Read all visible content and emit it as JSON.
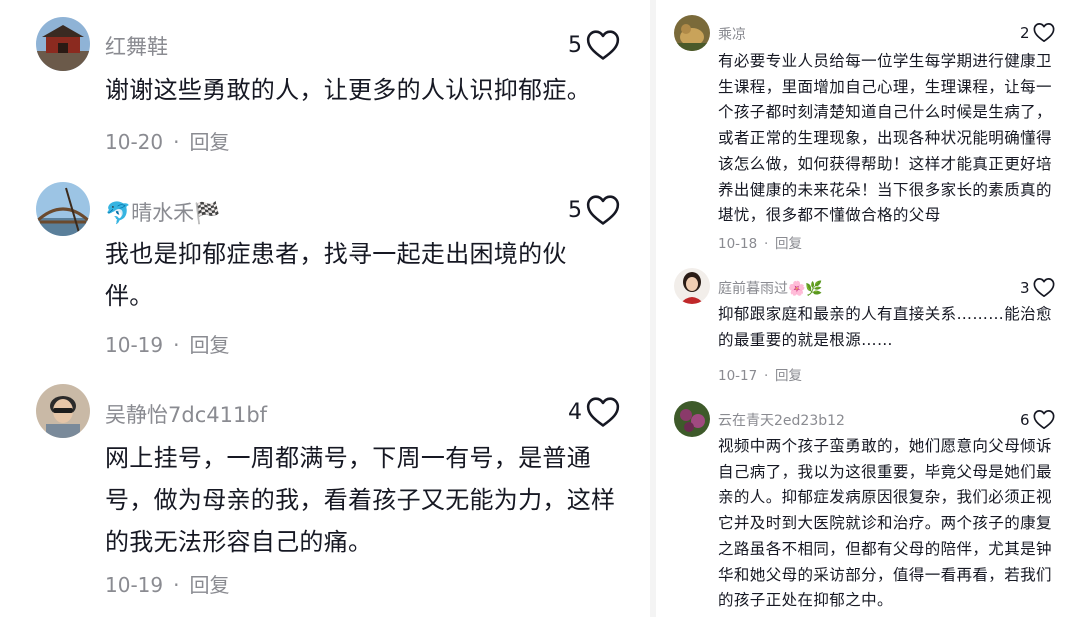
{
  "left_comments": [
    {
      "username": "红舞鞋",
      "text": "谢谢这些勇敢的人，让更多的人认识抑郁症。",
      "date": "10-20",
      "reply_label": "回复",
      "likes": "5",
      "avatar_icon": "building-photo-avatar"
    },
    {
      "username": "🐬晴水禾🏁",
      "text": "我也是抑郁症患者，找寻一起走出困境的伙伴。",
      "date": "10-19",
      "reply_label": "回复",
      "likes": "5",
      "avatar_icon": "bridge-photo-avatar"
    },
    {
      "username": "吴静怡7dc411bf",
      "text": "网上挂号，一周都满号，下周一有号，是普通号，做为母亲的我，看着孩子又无能为力，这样的我无法形容自己的痛。",
      "date": "10-19",
      "reply_label": "回复",
      "likes": "4",
      "avatar_icon": "person-photo-avatar"
    }
  ],
  "right_comments": [
    {
      "username": "乘凉",
      "text": "有必要专业人员给每一位学生每学期进行健康卫生课程，里面增加自己心理，生理课程，让每一个孩子都时刻清楚知道自己什么时候是生病了，或者正常的生理现象，出现各种状况能明确懂得该怎么做，如何获得帮助！这样才能真正更好培养出健康的未来花朵！当下很多家长的素质真的堪忧，很多都不懂做合格的父母",
      "date": "10-18",
      "reply_label": "回复",
      "likes": "2",
      "avatar_icon": "animal-photo-avatar"
    },
    {
      "username": "庭前暮雨过🌸🌿",
      "text": "抑郁跟家庭和最亲的人有直接关系………能治愈的最重要的就是根源……",
      "date": "10-17",
      "reply_label": "回复",
      "likes": "3",
      "avatar_icon": "woman-photo-avatar"
    },
    {
      "username": "云在青天2ed23b12",
      "text": "视频中两个孩子蛮勇敢的，她们愿意向父母倾诉自己病了，我以为这很重要，毕竟父母是她们最亲的人。抑郁症发病原因很复杂，我们必须正视它并及时到大医院就诊和治疗。两个孩子的康复之路虽各不相同，但都有父母的陪伴，尤其是钟华和她父母的采访部分，值得一看再看，若我们的孩子正处在抑郁之中。",
      "likes": "6",
      "avatar_icon": "flowers-photo-avatar"
    }
  ],
  "colors": {
    "text": "#161823",
    "secondary": "#8a8b91",
    "divider": "#f4f4f4"
  },
  "icons": {
    "like": "heart-outline-icon"
  }
}
